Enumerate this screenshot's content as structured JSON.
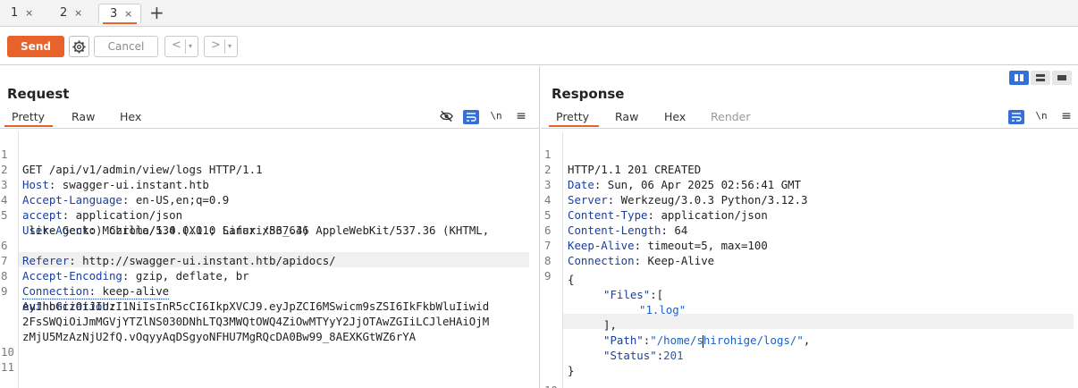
{
  "tabs": [
    {
      "label": "1",
      "close": "×"
    },
    {
      "label": "2",
      "close": "×"
    },
    {
      "label": "3",
      "close": "×"
    }
  ],
  "new_tab": "+",
  "toolbar": {
    "send_label": "Send",
    "cancel_label": "Cancel",
    "back_arrow": "<",
    "forward_arrow": ">",
    "dropdown": "▾"
  },
  "request": {
    "title": "Request",
    "tabs": [
      "Pretty",
      "Raw",
      "Hex"
    ],
    "active_tab": "Pretty",
    "lines": {
      "l1": "GET /api/v1/admin/view/logs HTTP/1.1",
      "l2_key": "Host",
      "l2_val": ": swagger-ui.instant.htb",
      "l3_key": "Accept-Language",
      "l3_val": ": en-US,en;q=0.9",
      "l4_key": "accept",
      "l4_val": ": application/json",
      "l5_key": "User-Agent",
      "l5_val": ": Mozilla/5.0 (X11; Linux x86_64) AppleWebKit/537.36 (KHTML,",
      "l5_cont": " like Gecko) Chrome/134.0.0.0 Safari/537.36",
      "l6_key": "Referer",
      "l6_val": ": http://swagger-ui.instant.htb/apidocs/",
      "l7_key": "Accept-Encoding",
      "l7_val": ": gzip, deflate, br",
      "l8_key": "Connection",
      "l8_val": ": keep-alive",
      "l9_key": "Authorization",
      "l9_val": ":",
      "l9_c1": "eyJhbGciOiJIUzI1NiIsInR5cCI6IkpXVCJ9.eyJpZCI6MSwicm9sZSI6IkFkbWluIiwid",
      "l9_c2": "2FsSWQiOiJmMGVjYTZlNS030DNhLTQ3MWQtOWQ4ZiOwMTYyY2JjOTAwZGIiLCJleHAiOjM",
      "l9_c3": "zMjU5MzAzNjU2fQ.vOqyyAqDSgyoNFHU7MgRQcDA0Bw99_8AEXKGtWZ6rYA"
    },
    "line_numbers": [
      "1",
      "2",
      "3",
      "4",
      "5",
      "6",
      "7",
      "8",
      "9",
      "10",
      "11"
    ]
  },
  "response": {
    "title": "Response",
    "tabs": [
      "Pretty",
      "Raw",
      "Hex",
      "Render"
    ],
    "active_tab": "Pretty",
    "lines": {
      "l1": "HTTP/1.1 201 CREATED",
      "l2_key": "Date",
      "l2_val": ": Sun, 06 Apr 2025 02:56:41 GMT",
      "l3_key": "Server",
      "l3_val": ": Werkzeug/3.0.3 Python/3.12.3",
      "l4_key": "Content-Type",
      "l4_val": ": application/json",
      "l5_key": "Content-Length",
      "l5_val": ": 64",
      "l6_key": "Keep-Alive",
      "l6_val": ": timeout=5, max=100",
      "l7_key": "Connection",
      "l7_val": ": Keep-Alive",
      "j_open": "{",
      "j_files_key": "\"Files\"",
      "j_files_sep": ":[",
      "j_file1": "\"1.log\"",
      "j_files_close": "],",
      "j_path_key": "\"Path\"",
      "j_path_sep": ":",
      "j_path_val_a": "\"/home/s",
      "j_path_val_b": "hirohige/logs/\"",
      "j_path_end": ",",
      "j_status_key": "\"Status\"",
      "j_status_sep": ":",
      "j_status_val": "201",
      "j_close": "}"
    },
    "line_numbers": [
      "1",
      "2",
      "3",
      "4",
      "5",
      "6",
      "7",
      "8",
      "9",
      "10"
    ]
  },
  "icons": {
    "settings": "gear-icon",
    "hide": "eye-off-icon",
    "wrap": "wrap-icon",
    "newline": "\\n",
    "menu": "≡"
  },
  "colors": {
    "accent": "#e8622c",
    "toggle_blue": "#3470d8",
    "header_key": "#1a3e9a"
  }
}
